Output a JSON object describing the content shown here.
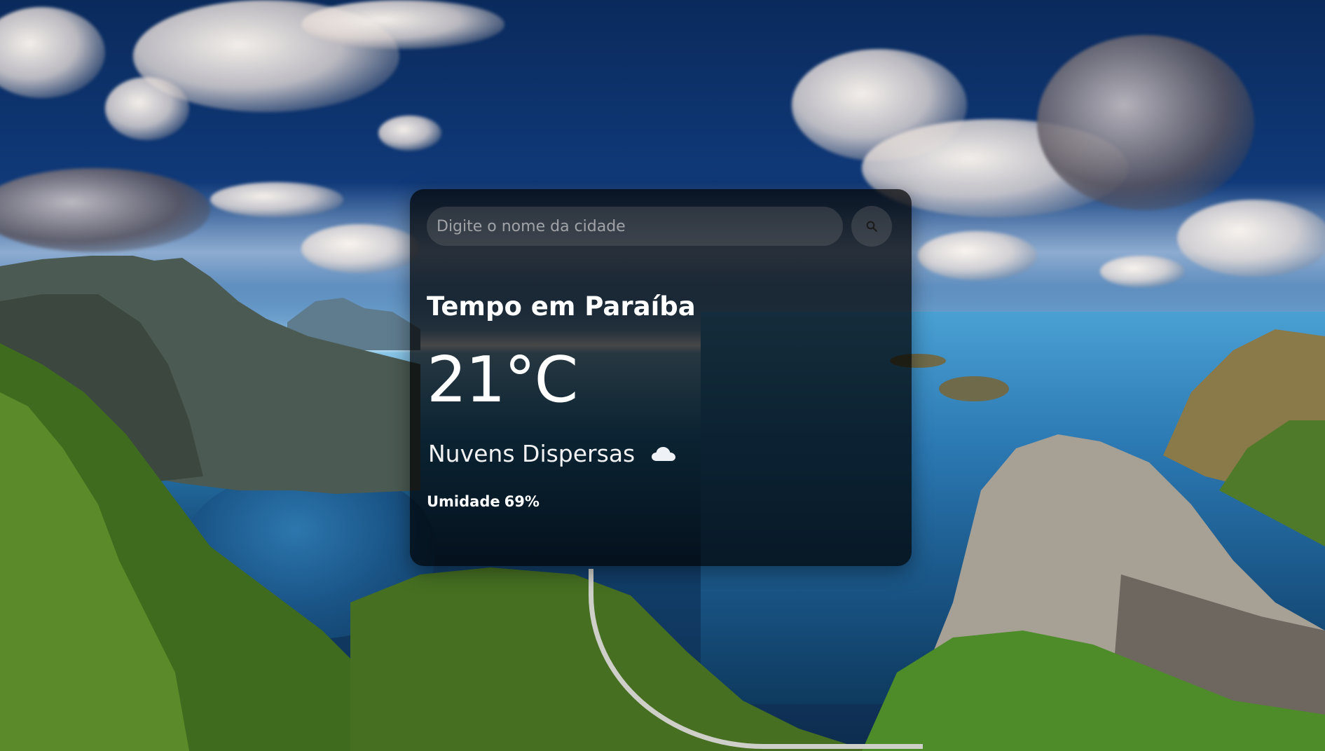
{
  "search": {
    "placeholder": "Digite o nome da cidade",
    "value": "",
    "button_icon": "search-icon"
  },
  "weather": {
    "title": "Tempo em Paraíba",
    "temperature": "21°C",
    "description": "Nuvens Dispersas",
    "description_icon": "cloud-icon",
    "humidity_label": "Umidade",
    "humidity_value": "69%"
  },
  "colors": {
    "card_background": "#000000",
    "text": "#ffffff",
    "input_background": "#7d7d7d"
  }
}
